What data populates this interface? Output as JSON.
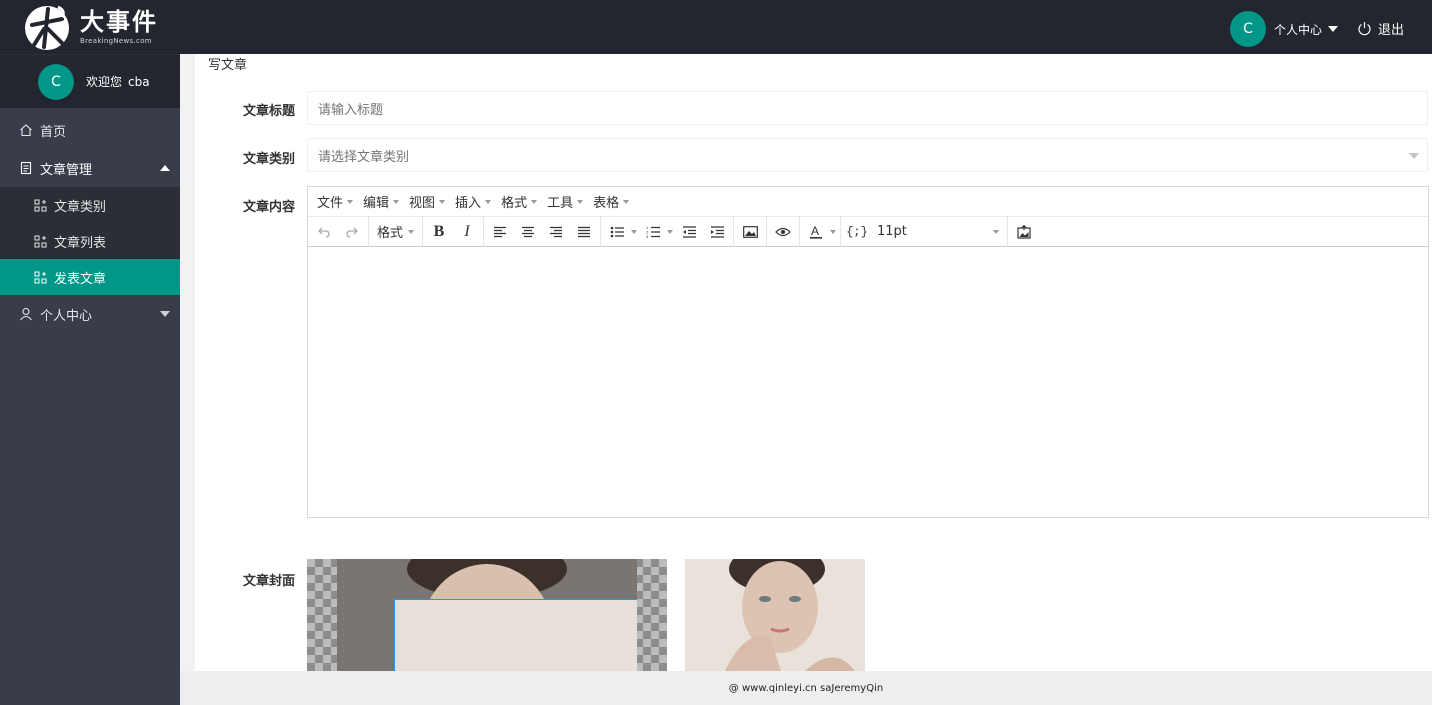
{
  "app": {
    "logo_cn": "大事件",
    "logo_en": "BreakingNews.com"
  },
  "sidebar": {
    "avatar_letter": "C",
    "welcome": "欢迎您",
    "username": "cba",
    "items": [
      {
        "label": "首页",
        "icon": "home-icon"
      },
      {
        "label": "文章管理",
        "icon": "article-icon",
        "expanded": true
      },
      {
        "label": "个人中心",
        "icon": "user-icon",
        "expanded": false
      }
    ],
    "subitems": [
      {
        "label": "文章类别",
        "icon": "app-grid-icon",
        "active": false
      },
      {
        "label": "文章列表",
        "icon": "app-grid-icon",
        "active": false
      },
      {
        "label": "发表文章",
        "icon": "app-grid-icon",
        "active": true
      }
    ]
  },
  "header": {
    "avatar_letter": "C",
    "personal_center": "个人中心",
    "logout": "退出"
  },
  "form": {
    "card_title": "写文章",
    "title_label": "文章标题",
    "title_placeholder": "请输入标题",
    "category_label": "文章类别",
    "category_placeholder": "请选择文章类别",
    "content_label": "文章内容",
    "cover_label": "文章封面"
  },
  "editor": {
    "menus": [
      "文件",
      "编辑",
      "视图",
      "插入",
      "格式",
      "工具",
      "表格"
    ],
    "format_select": "格式",
    "font_size": "11pt"
  },
  "footer": {
    "text": "@ www.qinleyi.cn saJeremyQin"
  },
  "colors": {
    "accent": "#009688",
    "sidebar_bg": "#393d49",
    "header_bg": "#23262e"
  }
}
